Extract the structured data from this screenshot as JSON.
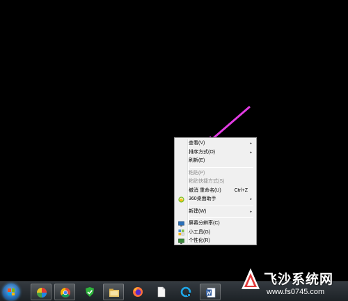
{
  "context_menu": {
    "items": [
      {
        "label": "查看(V)",
        "submenu": true,
        "disabled": false
      },
      {
        "label": "排序方式(O)",
        "submenu": true,
        "disabled": false
      },
      {
        "label": "刷新(E)",
        "submenu": false,
        "disabled": false
      },
      {
        "label": "粘贴(P)",
        "submenu": false,
        "disabled": true
      },
      {
        "label": "粘贴快捷方式(S)",
        "submenu": false,
        "disabled": true
      },
      {
        "label": "撤消 重命名(U)",
        "shortcut": "Ctrl+Z",
        "submenu": false,
        "disabled": false
      },
      {
        "label": "360桌面助手",
        "icon": "360-desktop-helper-icon",
        "submenu": true,
        "disabled": false
      },
      {
        "label": "新建(W)",
        "submenu": true,
        "disabled": false
      },
      {
        "label": "屏幕分辨率(C)",
        "icon": "screen-resolution-icon",
        "submenu": false,
        "disabled": false
      },
      {
        "label": "小工具(G)",
        "icon": "gadgets-icon",
        "submenu": false,
        "disabled": false
      },
      {
        "label": "个性化(R)",
        "icon": "personalize-icon",
        "submenu": false,
        "disabled": false
      }
    ],
    "submenu_glyph": "▸"
  },
  "taskbar": {
    "pinned": [
      "start-button",
      "color-app-icon",
      "chrome-icon",
      "360-security-icon",
      "file-explorer-icon",
      "firefox-icon",
      "blank-document-icon",
      "browser-c-icon",
      "word-icon"
    ]
  },
  "watermark": {
    "name": "飞沙系统网",
    "url": "www.fs0745.com"
  },
  "colors": {
    "desktop": "#000000",
    "arrow": "#e23ce3",
    "menu_bg": "#f0f0f0"
  }
}
